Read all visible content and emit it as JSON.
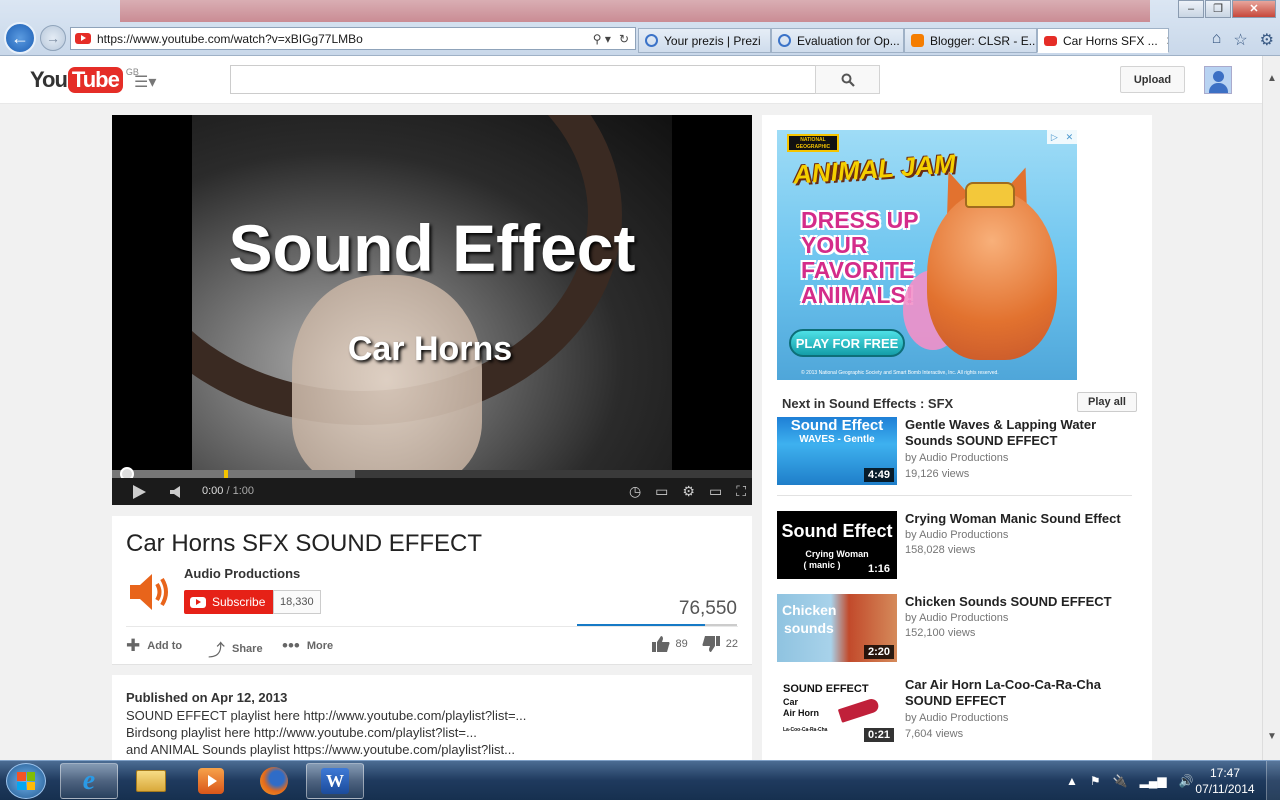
{
  "browser": {
    "address_url": "https://www.youtube.com/watch?v=xBIGg77LMBo",
    "tabs": [
      {
        "label": "Your prezis | Prezi",
        "icon": "prezi-icon"
      },
      {
        "label": "Evaluation for Op...",
        "icon": "prezi-icon"
      },
      {
        "label": "Blogger: CLSR - E...",
        "icon": "blogger-icon"
      },
      {
        "label": "Car Horns SFX ...",
        "icon": "youtube-icon",
        "close": "✕"
      }
    ]
  },
  "header": {
    "logo_you": "You",
    "logo_tube": "Tube",
    "region": "GB",
    "search_placeholder": "",
    "upload_label": "Upload"
  },
  "player": {
    "title_text": "Sound Effect",
    "subtitle_text": "Car Horns",
    "current_time": "0:00",
    "duration": "1:00",
    "buffered_fraction": 0.38
  },
  "video": {
    "title": "Car Horns SFX SOUND EFFECT",
    "channel": "Audio Productions",
    "subscribe_label": "Subscribe",
    "subscriber_count": "18,330",
    "views": "76,550",
    "likes": "89",
    "dislikes": "22",
    "like_fraction": 0.8,
    "actions": {
      "add_to": "Add to",
      "share": "Share",
      "more": "More"
    }
  },
  "description": {
    "published": "Published on Apr 12, 2013",
    "lines": [
      "SOUND EFFECT playlist here http://www.youtube.com/playlist?list=...",
      "Birdsong playlist here http://www.youtube.com/playlist?list=...",
      "and ANIMAL Sounds playlist https://www.youtube.com/playlist?list..."
    ]
  },
  "ad": {
    "brand": "NATIONAL GEOGRAPHIC",
    "logo": "ANIMAL JAM",
    "headline": "DRESS UP YOUR FAVORITE ANIMALS!",
    "cta": "PLAY FOR FREE",
    "copyright": "© 2013 National Geographic Society and Smart Bomb Interactive, Inc. All rights reserved."
  },
  "sidebar": {
    "up_next_label": "Next in Sound Effects : SFX",
    "play_all_label": "Play all",
    "related": [
      {
        "thumb_line1": "Sound Effect",
        "thumb_line2": "WAVES - Gentle",
        "duration": "4:49",
        "title": "Gentle Waves & Lapping Water Sounds SOUND EFFECT",
        "by": "by Audio Productions",
        "views": "19,126 views"
      },
      {
        "thumb_line1": "Sound Effect",
        "thumb_line2": "Crying Woman",
        "thumb_line3": "( manic )",
        "duration": "1:16",
        "title": "Crying Woman Manic Sound Effect",
        "by": "by Audio Productions",
        "views": "158,028 views"
      },
      {
        "thumb_line1": "Chicken",
        "thumb_line2": "sounds",
        "duration": "2:20",
        "title": "Chicken Sounds SOUND EFFECT",
        "by": "by Audio Productions",
        "views": "152,100 views"
      },
      {
        "thumb_line1": "SOUND EFFECT",
        "thumb_line2": "Car",
        "thumb_line3": "Air Horn",
        "thumb_line4": "La-Coo-Ca-Ra-Cha",
        "duration": "0:21",
        "title": "Car Air Horn La-Coo-Ca-Ra-Cha SOUND EFFECT",
        "by": "by Audio Productions",
        "views": "7,604 views"
      }
    ]
  },
  "taskbar": {
    "time": "17:47",
    "date": "07/11/2014"
  }
}
